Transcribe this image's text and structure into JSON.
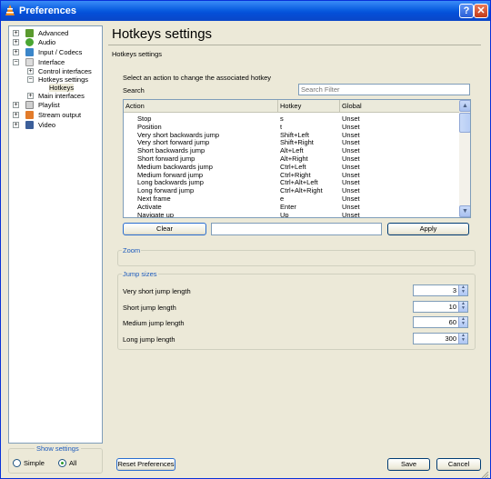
{
  "window": {
    "title": "Preferences",
    "help_label": "?",
    "close_label": "✕"
  },
  "sidebar": {
    "items": [
      {
        "label": "Advanced",
        "icon": "advanced-icon",
        "color": "#5a9a2e"
      },
      {
        "label": "Audio",
        "icon": "audio-icon",
        "color": "#4aa632"
      },
      {
        "label": "Input / Codecs",
        "icon": "input-codecs-icon",
        "color": "#3b86c9"
      },
      {
        "label": "Interface",
        "icon": "interface-icon",
        "color": "#dcdcdc"
      },
      {
        "label": "Control interfaces",
        "icon": "",
        "color": ""
      },
      {
        "label": "Hotkeys settings",
        "icon": "",
        "color": ""
      },
      {
        "label": "Hotkeys",
        "icon": "",
        "color": ""
      },
      {
        "label": "Main interfaces",
        "icon": "",
        "color": ""
      },
      {
        "label": "Playlist",
        "icon": "playlist-icon",
        "color": "#cfcfcf"
      },
      {
        "label": "Stream output",
        "icon": "stream-output-icon",
        "color": "#e27b2a"
      },
      {
        "label": "Video",
        "icon": "video-icon",
        "color": "#3c5f9a"
      }
    ],
    "show_settings": {
      "legend": "Show settings",
      "simple_label": "Simple",
      "all_label": "All",
      "selected": "All"
    }
  },
  "main": {
    "title": "Hotkeys settings",
    "subtitle": "Hotkeys settings",
    "intro": "Select an action to change the associated hotkey",
    "search_label": "Search",
    "search_placeholder": "Search Filter",
    "table": {
      "columns": [
        "Action",
        "Hotkey",
        "Global"
      ],
      "rows": [
        {
          "action": "Stop",
          "hotkey": "s",
          "global": "Unset"
        },
        {
          "action": "Position",
          "hotkey": "t",
          "global": "Unset"
        },
        {
          "action": "Very short backwards jump",
          "hotkey": "Shift+Left",
          "global": "Unset"
        },
        {
          "action": "Very short forward jump",
          "hotkey": "Shift+Right",
          "global": "Unset"
        },
        {
          "action": "Short backwards jump",
          "hotkey": "Alt+Left",
          "global": "Unset"
        },
        {
          "action": "Short forward jump",
          "hotkey": "Alt+Right",
          "global": "Unset"
        },
        {
          "action": "Medium backwards jump",
          "hotkey": "Ctrl+Left",
          "global": "Unset"
        },
        {
          "action": "Medium forward jump",
          "hotkey": "Ctrl+Right",
          "global": "Unset"
        },
        {
          "action": "Long backwards jump",
          "hotkey": "Ctrl+Alt+Left",
          "global": "Unset"
        },
        {
          "action": "Long forward jump",
          "hotkey": "Ctrl+Alt+Right",
          "global": "Unset"
        },
        {
          "action": "Next frame",
          "hotkey": "e",
          "global": "Unset"
        },
        {
          "action": "Activate",
          "hotkey": "Enter",
          "global": "Unset"
        },
        {
          "action": "Navigate up",
          "hotkey": "Up",
          "global": "Unset"
        }
      ]
    },
    "clear_label": "Clear",
    "hotkey_value": "",
    "apply_label": "Apply",
    "zoom_legend": "Zoom",
    "jump_legend": "Jump sizes",
    "jump_sizes": [
      {
        "label": "Very short jump length",
        "value": "3"
      },
      {
        "label": "Short jump length",
        "value": "10"
      },
      {
        "label": "Medium jump length",
        "value": "60"
      },
      {
        "label": "Long jump length",
        "value": "300"
      }
    ]
  },
  "footer": {
    "reset_label": "Reset Preferences",
    "save_label": "Save",
    "cancel_label": "Cancel"
  }
}
